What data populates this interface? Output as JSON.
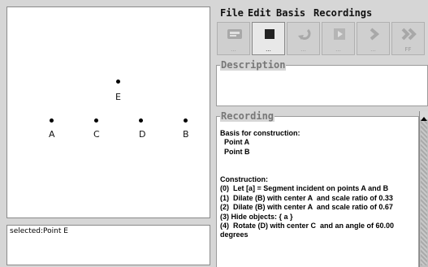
{
  "menu": {
    "file": "File",
    "edit": "Edit",
    "basis": "Basis",
    "recordings": "Recordings"
  },
  "toolbar": {
    "buttons": [
      {
        "icon": "widget-icon",
        "caption": "..."
      },
      {
        "icon": "stop-icon",
        "caption": "..."
      },
      {
        "icon": "undo-icon",
        "caption": "..."
      },
      {
        "icon": "play-icon",
        "caption": "..."
      },
      {
        "icon": "step-forward-icon",
        "caption": "..."
      },
      {
        "icon": "fast-forward-icon",
        "caption": "FF"
      }
    ]
  },
  "canvas": {
    "points": [
      {
        "label": "E"
      },
      {
        "label": "A"
      },
      {
        "label": "C"
      },
      {
        "label": "D"
      },
      {
        "label": "B"
      }
    ]
  },
  "status": {
    "text": "selected:Point E"
  },
  "description": {
    "legend": "Description",
    "text": ""
  },
  "recording": {
    "legend": "Recording",
    "lines": [
      "Basis for construction:",
      "  Point A",
      "  Point B",
      "",
      "",
      "Construction:",
      "(0)  Let [a] = Segment incident on points A and B",
      "(1)  Dilate (B) with center A  and scale ratio of 0.33",
      "(2)  Dilate (B) with center A  and scale ratio of 0.67",
      "(3) Hide objects: { a }",
      "(4)  Rotate (D) with center C  and an angle of 60.00",
      "degrees"
    ]
  },
  "colors": {
    "background": "#d6d6d6",
    "panel": "#ffffff",
    "disabled_icon": "#9a9a9a"
  }
}
